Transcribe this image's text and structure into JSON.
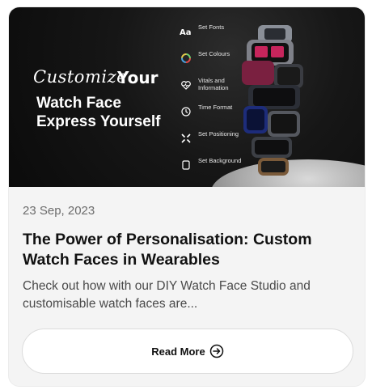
{
  "banner": {
    "headline_script": "Customize",
    "headline_word": "Your",
    "tagline_1": "Watch Face",
    "tagline_2": "Express Yourself",
    "features": [
      {
        "icon": "font-icon",
        "label": "Set Fonts"
      },
      {
        "icon": "colour-wheel-icon",
        "label": "Set Colours"
      },
      {
        "icon": "heart-icon",
        "label": "Vitals and Information"
      },
      {
        "icon": "clock-icon",
        "label": "Time Format"
      },
      {
        "icon": "positioning-icon",
        "label": "Set Positioning"
      },
      {
        "icon": "background-icon",
        "label": "Set Background"
      }
    ]
  },
  "post": {
    "date": "23 Sep, 2023",
    "title": "The Power of Personalisation: Custom Watch Faces in Wearables",
    "excerpt": "Check out how with our DIY Watch Face Studio and customisable watch faces are...",
    "read_more_label": "Read More"
  }
}
